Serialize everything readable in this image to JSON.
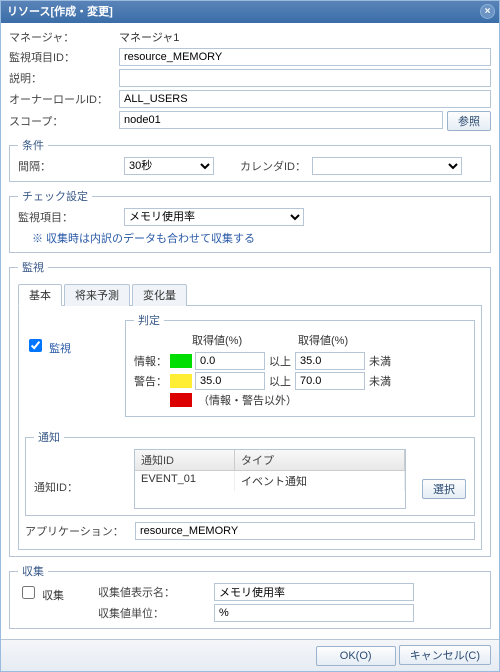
{
  "title": "リソース[作成・変更]",
  "form": {
    "manager_label": "マネージャ：",
    "manager_value": "マネージャ1",
    "monitor_id_label": "監視項目ID：",
    "monitor_id_value": "resource_MEMORY",
    "desc_label": "説明：",
    "desc_value": "",
    "owner_role_label": "オーナーロールID：",
    "owner_role_value": "ALL_USERS",
    "scope_label": "スコープ：",
    "scope_value": "node01",
    "scope_button": "参照"
  },
  "conditions": {
    "legend": "条件",
    "interval_label": "間隔：",
    "interval_value": "30秒",
    "calendar_label": "カレンダID：",
    "calendar_value": ""
  },
  "check": {
    "legend": "チェック設定",
    "monitor_item_label": "監視項目：",
    "monitor_item_value": "メモリ使用率",
    "note": "※ 収集時は内訳のデータも合わせて収集する"
  },
  "monitor": {
    "legend": "監視",
    "tabs": [
      "基本",
      "将来予測",
      "変化量"
    ],
    "check_label": "監視",
    "judgment": {
      "legend": "判定",
      "header_col1": "取得値(%)",
      "header_col2": "取得値(%)",
      "info_label": "情報：",
      "info_low": "0.0",
      "info_op": "以上",
      "info_high": "35.0",
      "info_trail": "未満",
      "warn_label": "警告：",
      "warn_low": "35.0",
      "warn_op": "以上",
      "warn_high": "70.0",
      "warn_trail": "未満",
      "critical_note": "（情報・警告以外）"
    },
    "notify": {
      "legend": "通知",
      "col1": "通知ID",
      "col2": "タイプ",
      "row_id": "EVENT_01",
      "row_type": "イベント通知",
      "notify_id_label": "通知ID：",
      "select_button": "選択"
    },
    "app_label": "アプリケーション：",
    "app_value": "resource_MEMORY"
  },
  "collect": {
    "legend": "収集",
    "check_label": "収集",
    "name_label": "収集値表示名：",
    "name_value": "メモリ使用率",
    "unit_label": "収集値単位：",
    "unit_value": "%"
  },
  "footer": {
    "ok": "OK(O)",
    "cancel": "キャンセル(C)"
  }
}
